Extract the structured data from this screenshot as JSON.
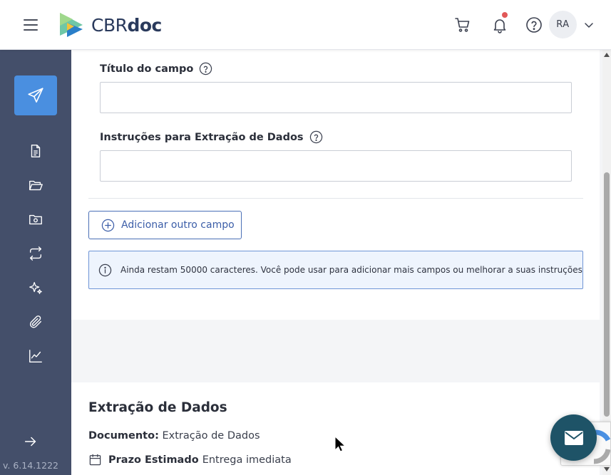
{
  "header": {
    "logo_text_prefix": "CBR",
    "logo_text_suffix": "doc",
    "avatar_initials": "RA",
    "icons": [
      "menu-icon",
      "cart-icon",
      "bell-icon",
      "help-icon",
      "chevron-down-icon"
    ],
    "notification_dot_color": "#e15858"
  },
  "sidebar": {
    "active_icon": "send-icon",
    "items": [
      "document-icon",
      "folder-open-icon",
      "folder-eye-icon",
      "sync-icon",
      "sparkles-icon",
      "paperclip-icon",
      "chart-line-icon"
    ],
    "expand_icon": "arrow-right-icon",
    "version": "v. 6.14.1222",
    "bg_color": "#444f6a",
    "accent_color": "#4a8fe0"
  },
  "form": {
    "field_title_label": "Título do campo",
    "field_title_value": "",
    "instructions_label": "Instruções para Extração de Dados",
    "instructions_value": "",
    "add_field_label": "Adicionar outro campo",
    "info_text": "Ainda restam 50000 caracteres. Você pode usar para adicionar mais campos ou melhorar a suas instruções"
  },
  "summary": {
    "title": "Extração de Dados",
    "document_label": "Documento:",
    "document_value": "Extração de Dados",
    "deadline_label": "Prazo Estimado",
    "deadline_value": "Entrega imediata"
  },
  "floating": {
    "chat_icon": "envelope-icon",
    "chat_color": "#1e5367"
  }
}
